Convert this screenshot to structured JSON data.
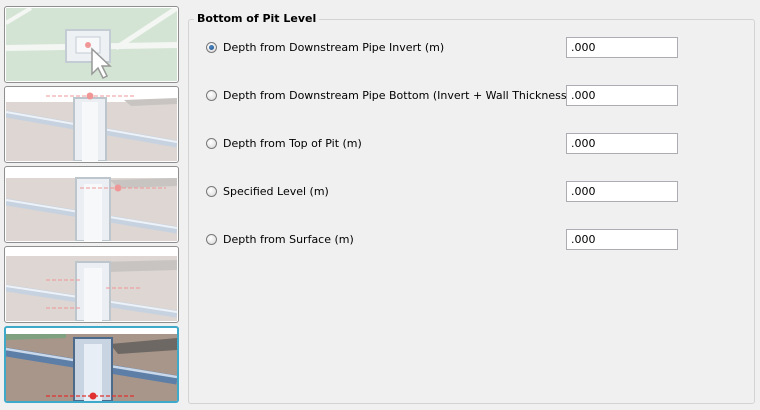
{
  "group": {
    "title": "Bottom of Pit Level"
  },
  "options": [
    {
      "label": "Depth from Downstream Pipe Invert (m)",
      "value": ".000",
      "checked": true
    },
    {
      "label": "Depth from Downstream Pipe Bottom (Invert + Wall Thickness) (m)",
      "value": ".000",
      "checked": false
    },
    {
      "label": "Depth from Top of Pit (m)",
      "value": ".000",
      "checked": false
    },
    {
      "label": "Specified Level (m)",
      "value": ".000",
      "checked": false
    },
    {
      "label": "Depth from Surface (m)",
      "value": ".000",
      "checked": false
    }
  ],
  "thumbnails": [
    {
      "view": "plan",
      "icon": "plan-view-pit-icon",
      "selected": false
    },
    {
      "view": "section-downstream-invert",
      "icon": "section-invert-icon",
      "selected": false
    },
    {
      "view": "section-pipe-bottom",
      "icon": "section-pipe-bottom-icon",
      "selected": false
    },
    {
      "view": "section-top-of-pit",
      "icon": "section-top-of-pit-icon",
      "selected": false
    },
    {
      "view": "section-pit-bottom",
      "icon": "section-pit-bottom-icon",
      "selected": true
    }
  ],
  "colors": {
    "selected_border": "#3fa9c9",
    "marker": "#e03030",
    "ground": "#bcaea6",
    "grass": "#b9cfb9",
    "pipe": "#9fb3cc"
  }
}
